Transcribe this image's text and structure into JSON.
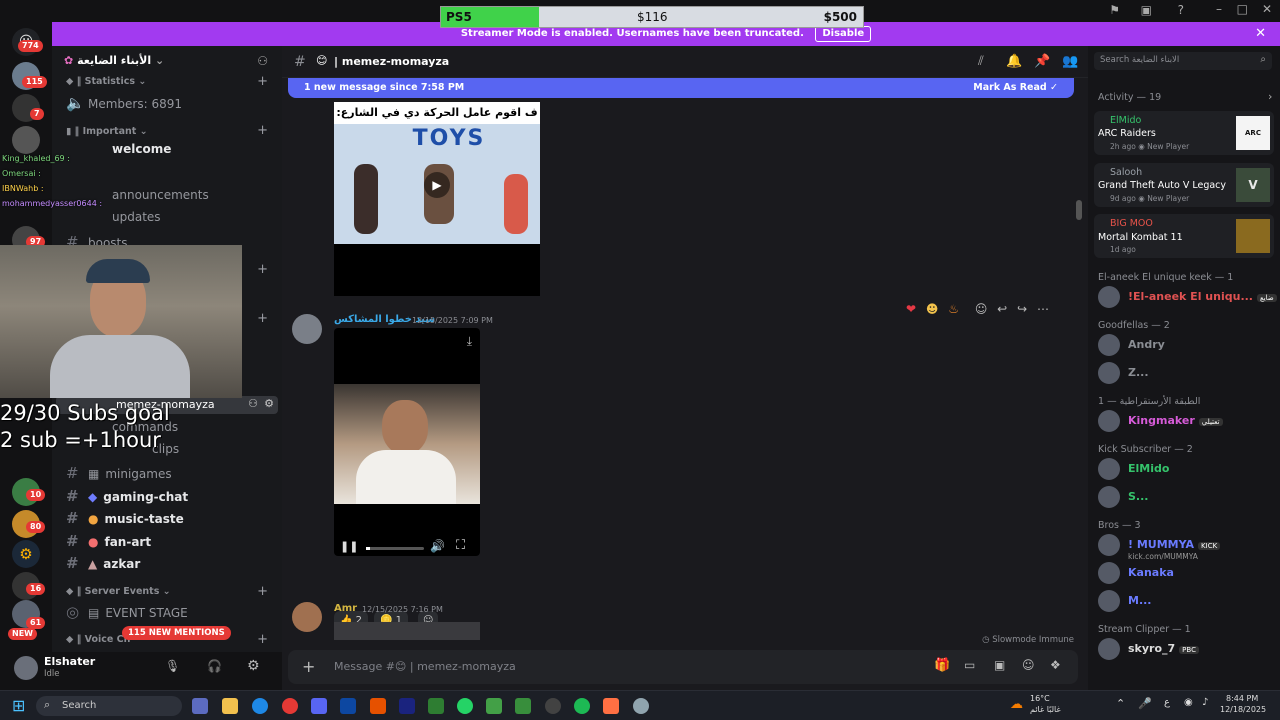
{
  "overlay": {
    "goal_bar": {
      "label": "PS5",
      "current": "$116",
      "target": "$500",
      "progress": 0.232
    },
    "subs_goal": "29/30 Subs goal",
    "sub_hour": "2 sub =+1hour",
    "chat_lines": [
      "King_khaled_69 :",
      "Omersai :",
      "IBNWahb :",
      "mohammedyasser0644 :"
    ]
  },
  "streamer_bar": {
    "text": "Streamer Mode is enabled. Usernames have been truncated.",
    "disable": "Disable"
  },
  "server_rail": {
    "badges": [
      "774",
      "115",
      "7",
      "97",
      "10",
      "80",
      "16",
      "61"
    ],
    "new_label": "NEW"
  },
  "sidebar": {
    "server_name": "الأبناء الضايعة",
    "sections": {
      "statistics": "Statistics",
      "members": "Members: 6891",
      "important": "Important",
      "server_events": "Server Events",
      "voice": "Voice Ch"
    },
    "channels": [
      "welcome",
      "announcements",
      "updates",
      "boosts",
      "memez-momayza",
      "commands",
      "clips",
      "minigames",
      "gaming-chat",
      "music-taste",
      "fan-art",
      "azkar"
    ],
    "event_stage": "EVENT STAGE",
    "new_mentions": "115 NEW MENTIONS",
    "user": {
      "name": "Elshater",
      "status": "Idle"
    }
  },
  "chat": {
    "channel": "memez-momayza",
    "new_banner": "1 new message since 7:58 PM",
    "mark_read": "Mark As Read",
    "meme_caption": "ف اقوم عامل الحركة دي في الشارع:",
    "meme_sign": "TOYS",
    "messages": [
      {
        "author": "سيد خطوا المشاكس",
        "time": "12/15/2025 7:09 PM",
        "author_color": "#3aa9e8"
      },
      {
        "author": "Amr",
        "time": "12/15/2025 7:16 PM",
        "author_color": "#d4b641"
      }
    ],
    "reactions": [
      {
        "emoji": "👍",
        "count": "2"
      },
      {
        "emoji": "🪙",
        "count": "1"
      }
    ],
    "composer_placeholder": "Message #😊 | memez-momayza",
    "slowmode": "Slowmode Immune"
  },
  "right_panel": {
    "search_placeholder": "Search الابناء الضايعة",
    "activity_title": "Activity — 19",
    "activities": [
      {
        "user": "ElMido",
        "game": "ARC Raiders",
        "meta": "2h ago",
        "tag": "New Player",
        "user_color": "#35c36b"
      },
      {
        "user": "Salooh",
        "game": "Grand Theft Auto V Legacy",
        "meta": "9d ago",
        "tag": "New Player",
        "user_color": "#9aa0a8"
      },
      {
        "user": "BIG MOO",
        "game": "Mortal Kombat 11",
        "meta": "1d ago",
        "tag": "",
        "user_color": "#e8534a"
      }
    ],
    "groups": [
      {
        "title": "El-aneek El unique keek — 1",
        "members": [
          {
            "name": "!El-aneek El uniqu...",
            "color": "#e05252",
            "tag": "ضايع"
          }
        ]
      },
      {
        "title": "Goodfellas — 2",
        "members": [
          {
            "name": "Andry",
            "color": "#8a8d93",
            "tag": ""
          },
          {
            "name": "Z...",
            "color": "#8a8d93",
            "tag": ""
          }
        ]
      },
      {
        "title": "الطبقة الأرستقراطية — 1",
        "members": [
          {
            "name": "Kingmaker",
            "color": "#d65bd8",
            "tag": "تعتيلي"
          }
        ]
      },
      {
        "title": "Kick Subscriber — 2",
        "members": [
          {
            "name": "ElMido",
            "color": "#35c36b",
            "tag": ""
          },
          {
            "name": "S...",
            "color": "#35c36b",
            "tag": ""
          }
        ]
      },
      {
        "title": "Bros — 3",
        "members": [
          {
            "name": "! MUMMYA",
            "color": "#6a7bff",
            "tag": "KICK",
            "sub": "kick.com/MUMMYA"
          },
          {
            "name": "Kanaka",
            "color": "#6a7bff",
            "tag": ""
          },
          {
            "name": "M...",
            "color": "#6a7bff",
            "tag": ""
          }
        ]
      },
      {
        "title": "Stream Clipper — 1",
        "members": [
          {
            "name": "skyro_7",
            "color": "#dcdcdc",
            "tag": "PBC"
          }
        ]
      }
    ]
  },
  "taskbar": {
    "search": "Search",
    "weather_temp": "16°C",
    "weather_desc": "غالبًا غائم",
    "time": "8:44 PM",
    "date": "12/18/2025"
  },
  "colors": {
    "accent": "#5865f2",
    "streamer": "#a23af0",
    "goal_fill": "#40d24a"
  }
}
